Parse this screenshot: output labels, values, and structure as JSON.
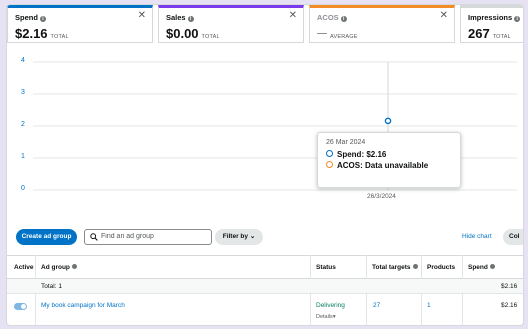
{
  "metrics": [
    {
      "label": "Spend",
      "value": "$2.16",
      "sub": "TOTAL",
      "accent": "#0073c7"
    },
    {
      "label": "Sales",
      "value": "$0.00",
      "sub": "TOTAL",
      "accent": "#7c3aed"
    },
    {
      "label": "ACOS",
      "value": "",
      "sub": "AVERAGE",
      "accent": "#f28c28"
    },
    {
      "label": "Impressions",
      "value": "267",
      "sub": "TOTAL",
      "accent": "#8d9096"
    }
  ],
  "chart_data": {
    "type": "scatter",
    "title": "",
    "xlabel": "",
    "ylabel": "",
    "ylim": [
      0,
      4
    ],
    "yticks": [
      "4",
      "3",
      "2",
      "1",
      "0"
    ],
    "x": [
      "26/3/2024"
    ],
    "series": [
      {
        "name": "Spend",
        "values": [
          2.16
        ],
        "color": "#0073c7"
      }
    ],
    "grid": true
  },
  "tooltip": {
    "date": "26 Mar 2024",
    "spend_label": "Spend:",
    "spend_value": "$2.16",
    "acos_label": "ACOS:",
    "acos_value": "Data unavailable"
  },
  "toolbar": {
    "create_label": "Create ad group",
    "search_placeholder": "Find an ad group",
    "filter_label": "Filter by",
    "hide_chart_label": "Hide chart",
    "columns_label": "Col"
  },
  "table": {
    "headers": {
      "active": "Active",
      "ad_group": "Ad group",
      "status": "Status",
      "total_targets": "Total targets",
      "products": "Products",
      "spend": "Spend"
    },
    "total_row": {
      "label": "Total: 1",
      "spend": "$2.16"
    },
    "rows": [
      {
        "name": "My book campaign for March",
        "status": "Delivering",
        "details": "Details",
        "targets": "27",
        "products": "1",
        "spend": "$2.16"
      }
    ]
  }
}
